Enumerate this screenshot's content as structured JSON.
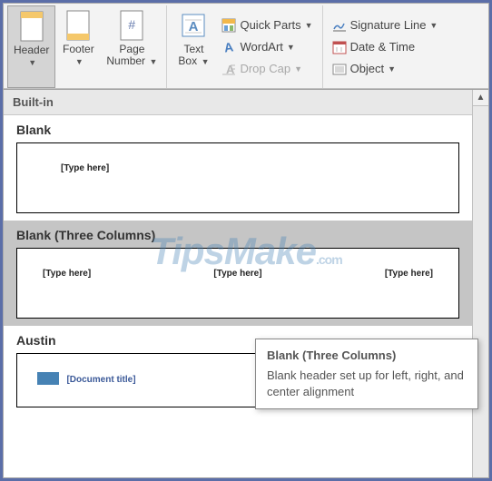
{
  "ribbon": {
    "header": "Header",
    "footer": "Footer",
    "pageNumber": "Page\nNumber",
    "textBox": "Text\nBox",
    "quickParts": "Quick Parts",
    "wordArt": "WordArt",
    "dropCap": "Drop Cap",
    "signatureLine": "Signature Line",
    "dateTime": "Date & Time",
    "object": "Object"
  },
  "gallery": {
    "sectionTitle": "Built-in",
    "items": [
      {
        "name": "Blank",
        "placeholders": [
          "[Type here]"
        ]
      },
      {
        "name": "Blank (Three Columns)",
        "placeholders": [
          "[Type here]",
          "[Type here]",
          "[Type here]"
        ]
      },
      {
        "name": "Austin",
        "docTitle": "[Document title]"
      }
    ]
  },
  "tooltip": {
    "title": "Blank (Three Columns)",
    "desc": "Blank header set up for left, right, and center alignment"
  },
  "watermark": {
    "text": "TipsMake",
    "suffix": ".com"
  }
}
